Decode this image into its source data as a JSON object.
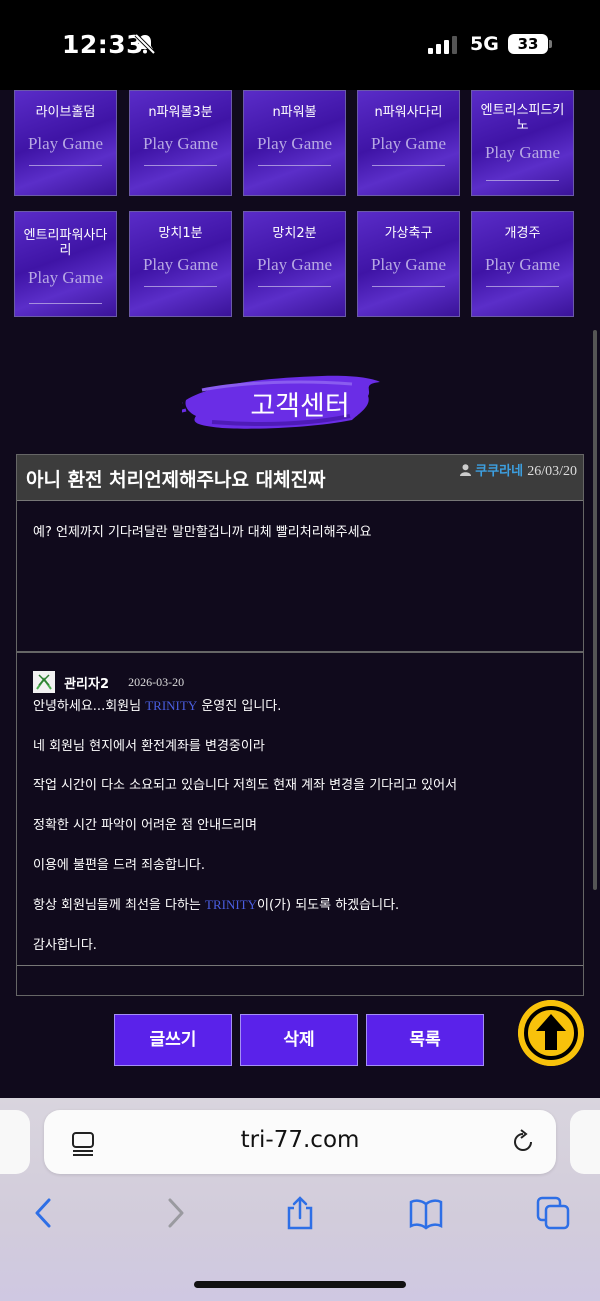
{
  "status": {
    "time": "12:33",
    "network": "5G",
    "battery": "33"
  },
  "games": [
    {
      "name": "라이브홀덤",
      "play": "Play Game"
    },
    {
      "name": "n파워볼3분",
      "play": "Play Game"
    },
    {
      "name": "n파워볼",
      "play": "Play Game"
    },
    {
      "name": "n파워사다리",
      "play": "Play Game"
    },
    {
      "name": "엔트리스피드키노",
      "play": "Play Game"
    },
    {
      "name": "엔트리파워사다리",
      "play": "Play Game"
    },
    {
      "name": "망치1분",
      "play": "Play Game"
    },
    {
      "name": "망치2분",
      "play": "Play Game"
    },
    {
      "name": "가상축구",
      "play": "Play Game"
    },
    {
      "name": "개경주",
      "play": "Play Game"
    }
  ],
  "section_title": "고객센터",
  "post": {
    "title": "아니 환전 처리언제해주나요 대체진짜",
    "author": "쿠쿠라네",
    "date": "26/03/20",
    "body": "예? 언제까지 기다려달란 말만할겁니까 대체 빨리처리해주세요"
  },
  "reply": {
    "author": "관리자2",
    "date": "2026-03-20",
    "greeting_a": "안녕하세요...회원님 ",
    "brand": "TRINITY",
    "greeting_b": " 운영진 입니다.",
    "line1": "네 회원님 현지에서 환전계좌를 변경중이라",
    "line2": "작업 시간이 다소 소요되고 있습니다 저희도 현재 계좌 변경을 기다리고 있어서",
    "line3": "정확한 시간 파악이 어려운 점 안내드리며",
    "line4": "이용에 불편을 드려 죄송합니다.",
    "line5_a": "항상 회원님들께 최선을 다하는 ",
    "line5_b": "이(가) 되도록 하겠습니다.",
    "line6": "감사합니다."
  },
  "buttons": {
    "write": "글쓰기",
    "delete": "삭제",
    "list": "목록"
  },
  "browser": {
    "url": "tri-77.com"
  }
}
